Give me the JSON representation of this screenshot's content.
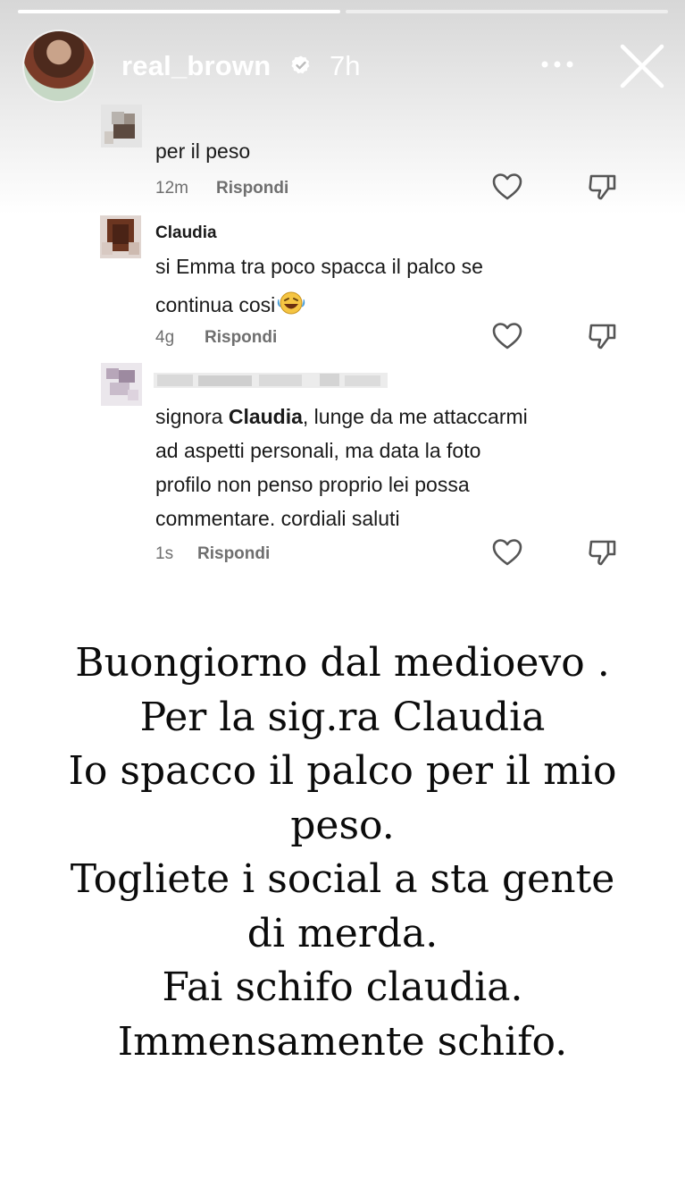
{
  "story": {
    "progress": [
      1.0,
      0.0
    ],
    "username": "real_brown",
    "time": "7h",
    "icons": [
      "verified-badge-icon",
      "more-options-icon",
      "close-icon"
    ]
  },
  "comments": [
    {
      "name": "",
      "text_lines": [
        "per il peso"
      ],
      "time": "12m",
      "reply_label": "Rispondi"
    },
    {
      "name": "Claudia",
      "text_lines": [
        "si Emma tra poco spacca il palco se",
        "continua cosi"
      ],
      "emoji": "😂",
      "time": "4g",
      "reply_label": "Rispondi"
    },
    {
      "name": "",
      "text_prefix": "signora ",
      "text_mention": "Claudia",
      "text_lines": [
        ", lunge da me attaccarmi",
        "ad aspetti personali, ma data la foto",
        "profilo non penso proprio lei possa",
        "commentare. cordiali saluti"
      ],
      "time": "1s",
      "reply_label": "Rispondi"
    }
  ],
  "caption_lines": [
    "Buongiorno dal medioevo .",
    "Per la sig.ra Claudia",
    "Io spacco il palco per il mio",
    "peso.",
    "Togliete i social a sta gente",
    "di merda.",
    "Fai schifo claudia.",
    "Immensamente schifo."
  ]
}
